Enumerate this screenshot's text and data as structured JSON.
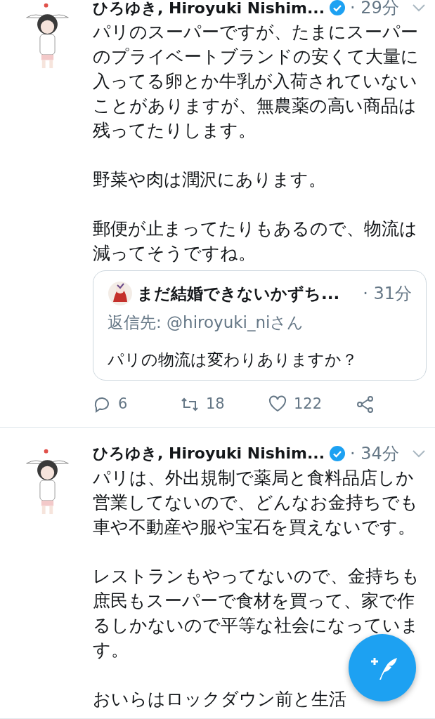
{
  "tweets": [
    {
      "author": "ひろゆき, Hiroyuki Nishim...",
      "verified": true,
      "time": "· 29分",
      "paragraphs": [
        "パリのスーパーですが、たまにスーパーのプライベートブランドの安くて大量に入ってる卵とか牛乳が入荷されていないことがありますが、無農薬の高い商品は残ってたりします。",
        "野菜や肉は潤沢にあります。",
        "郵便が止まってたりもあるので、物流は減ってそうですね。"
      ],
      "quote": {
        "author": "まだ結婚できないかずち...",
        "time": "· 31分",
        "reply_to": "返信先: @hiroyuki_niさん",
        "text": "パリの物流は変わりありますか？"
      },
      "actions": {
        "replies": "6",
        "retweets": "18",
        "likes": "122"
      }
    },
    {
      "author": "ひろゆき, Hiroyuki Nishim...",
      "verified": true,
      "time": "· 34分",
      "paragraphs": [
        "パリは、外出規制で薬局と食料品店しか営業してないので、どんなお金持ちでも車や不動産や服や宝石を買えないです。",
        "レストランもやってないので、金持ちも庶民もスーパーで食材を買って、家で作るしかないので平等な社会になっています。",
        "おいらはロックダウン前と生活"
      ]
    }
  ]
}
